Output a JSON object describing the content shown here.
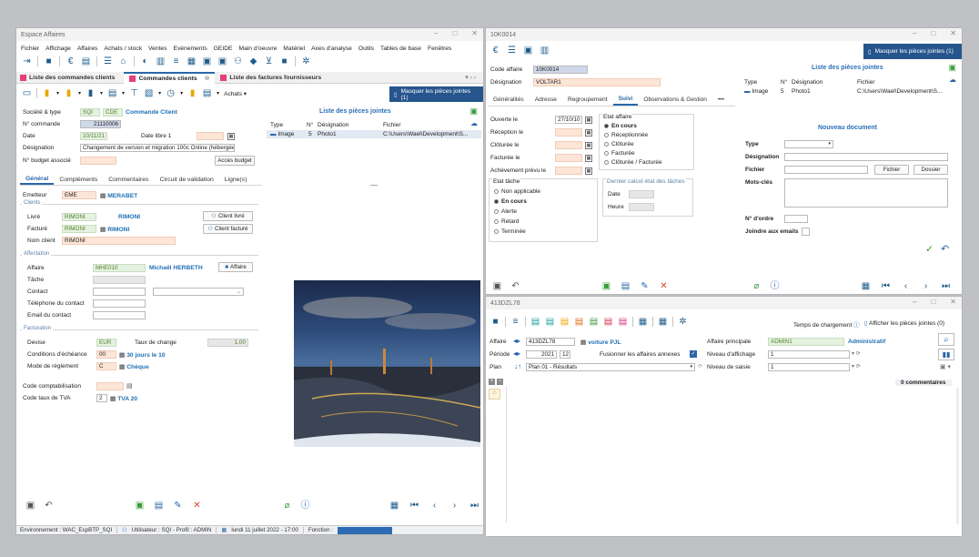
{
  "left": {
    "title": "Espace Affaires",
    "menu": [
      "Fichier",
      "Affichage",
      "Affaires",
      "Achats / stock",
      "Ventes",
      "Evénements",
      "GEIDE",
      "Main d'oeuvre",
      "Matériel",
      "Axes d'analyse",
      "Outils",
      "Tables de base",
      "Fenêtres"
    ],
    "doc_tabs": [
      "Liste des commandes clients",
      "Commandes clients",
      "Liste des factures fournisseurs"
    ],
    "achats_label": "Achats",
    "hide_attachments": "Masquer les pièces jointes (1)",
    "header": {
      "societe_label": "Société & type",
      "societe": "SQI",
      "type": "CDE",
      "type_name": "Commande Client",
      "num_label": "N° commande",
      "num": "21110006",
      "date_label": "Date",
      "date": "10/11/21",
      "date_libre_label": "Date libre 1",
      "designation_label": "Désignation",
      "designation": "Changement de version et migration 100c Online (hébergée)",
      "budget_label": "N° budget associé",
      "budget_btn": "Accès budget"
    },
    "attachments": {
      "title": "Liste des pièces jointes",
      "cols": [
        "Type",
        "N°",
        "Désignation",
        "Fichier"
      ],
      "row": [
        "Image",
        "5",
        "Photo1",
        "C:\\Users\\Wael\\Development\\S..."
      ]
    },
    "form_tabs": [
      "Général",
      "Compléments",
      "Commentaires",
      "Circuit de validation",
      "Ligne(s)"
    ],
    "emetteur_label": "Emetteur",
    "emetteur_code": "EME",
    "emetteur_name": "MERABET",
    "clients_section": "Clients",
    "livre_label": "Livré",
    "livre_code": "RIMONI",
    "livre_name": "RIMONI",
    "client_livre_btn": "Client livré",
    "facture_label": "Facturé",
    "facture_code": "RIMONI",
    "facture_name": "RIMONI",
    "client_facture_btn": "Client facturé",
    "nom_client_label": "Nom client",
    "nom_client": "RIMONI",
    "affectation_section": "Affectation",
    "affaire_label": "Affaire",
    "affaire_code": "MHE010",
    "affaire_name": "Michaël HERBETH",
    "affaire_btn": "Affaire",
    "tache_label": "Tâche",
    "contact_label": "Contact",
    "tel_label": "Téléphone du contact",
    "email_label": "Email du contact",
    "facturation_section": "Facturation",
    "devise_label": "Devise",
    "devise": "EUR",
    "taux_label": "Taux de change",
    "taux": "1.00",
    "cond_label": "Conditions d'échéance",
    "cond_code": "00",
    "cond_name": "30 jours le 10",
    "mode_label": "Mode de règlement",
    "mode_code": "C",
    "mode_name": "Chèque",
    "compta_label": "Code comptabilisation",
    "tva_label": "Code taux de TVA",
    "tva_code": "2",
    "tva_name": "TVA 20",
    "status": {
      "env": "Environnement : WAC_EspBTP_SQI",
      "user": "Utilisateur : SQI - Profil : ADMIN",
      "date": "lundi 11 juillet 2022 - 17:00",
      "fonction": "Fonction :"
    }
  },
  "right_top": {
    "title": "10K0014",
    "hide_attachments": "Masquer les pièces jointes (1)",
    "code_label": "Code affaire",
    "code": "10K0014",
    "designation_label": "Désignation",
    "designation": "VOLTAR1",
    "tabs": [
      "Généralités",
      "Adresse",
      "Regroupement",
      "Suivi",
      "Observations & Gestion",
      "•••"
    ],
    "ouverture_label": "Ouverte le",
    "ouverture": "27/10/10",
    "reception_label": "Réception le",
    "cloturee_label": "Clôturée le",
    "facturee_label": "Facturée le",
    "achevement_label": "Achèvement prévu le",
    "etat_affaire_title": "Etat affaire",
    "etat_affaire": [
      "En cours",
      "Réceptionnée",
      "Clôturée",
      "Facturée",
      "Clôturée / Facturée"
    ],
    "etat_tache_title": "Etat tâche",
    "etat_tache": [
      "Non applicable",
      "En cours",
      "Alerte",
      "Retard",
      "Terminée"
    ],
    "dernier_calc": "Dernier calcul état des tâches",
    "date_label": "Date",
    "heure_label": "Heure",
    "attachments": {
      "title": "Liste des pièces jointes",
      "cols": [
        "Type",
        "N°",
        "Désignation",
        "Fichier"
      ],
      "row": [
        "Image",
        "5",
        "Photo1",
        "C:\\Users\\Wael\\Development\\S..."
      ]
    },
    "new_doc": {
      "title": "Nouveau document",
      "type": "Type",
      "designation": "Désignation",
      "fichier": "Fichier",
      "fichier_btn": "Fichier",
      "dossier_btn": "Dossier",
      "mots": "Mots-clés",
      "ordre": "N° d'ordre",
      "joindre": "Joindre aux emails"
    }
  },
  "right_bottom": {
    "title": "413DZL78",
    "temps": "Temps de chargement",
    "afficher": "Afficher les pièces jointes (0)",
    "affaire_label": "Affaire",
    "affaire_code": "413DZL78",
    "affaire_name": "voiture PJL",
    "principale_label": "Affaire principale",
    "principale_code": "ADMIN1",
    "principale_name": "Administratif",
    "periode_label": "Période",
    "annee": "2021",
    "mois": "12",
    "fusion_label": "Fusionner les affaires annexes",
    "niveau_aff_label": "Niveau d'affichage",
    "niveau_aff": "1",
    "plan_label": "Plan",
    "plan": "Plan 01 - Résultats",
    "niveau_saisie_label": "Niveau de saisie",
    "niveau_saisie": "1",
    "commentaires": "0 commentaires"
  },
  "colors": {
    "accent": "#26558d",
    "link": "#1f6fb3",
    "green_icon": "#3a9b3a",
    "red_icon": "#d9432f"
  }
}
